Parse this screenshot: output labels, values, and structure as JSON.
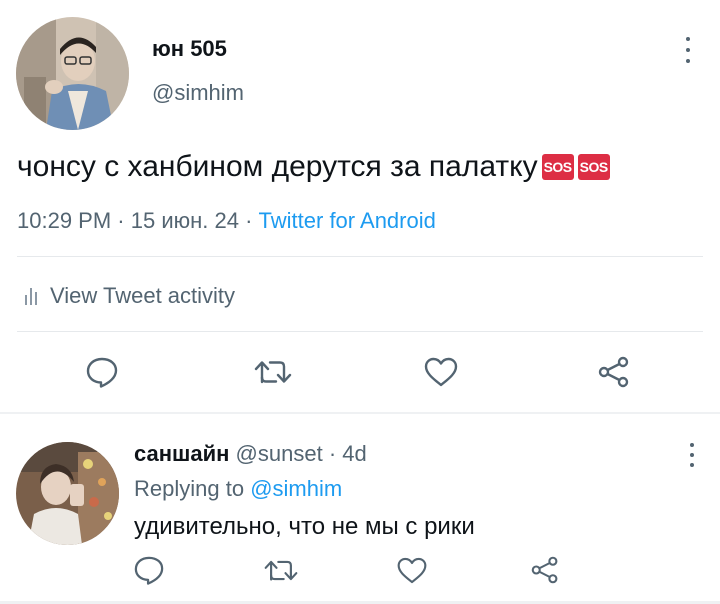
{
  "tweet": {
    "author": {
      "display_name": "юн 505",
      "handle": "@simhim"
    },
    "text": "чонсу с ханбином дерутся за палатку",
    "emojis": [
      "SOS",
      "SOS"
    ],
    "time": "10:29 PM",
    "separator": "·",
    "date": "15 июн. 24",
    "source": "Twitter for Android",
    "activity_label": "View Tweet activity",
    "actions": {
      "reply_icon": "reply-icon",
      "retweet_icon": "retweet-icon",
      "like_icon": "heart-icon",
      "share_icon": "share-icon"
    }
  },
  "reply": {
    "display_name": "саншайн",
    "handle": "@sunset",
    "time": "· 4d",
    "replying_label": "Replying to",
    "replying_to": "@simhim",
    "text": "удивительно, что не мы с рики"
  },
  "colors": {
    "text": "#0f1419",
    "secondary": "#536471",
    "link": "#1d9bf0",
    "emoji_sos": "#dd2e44"
  }
}
